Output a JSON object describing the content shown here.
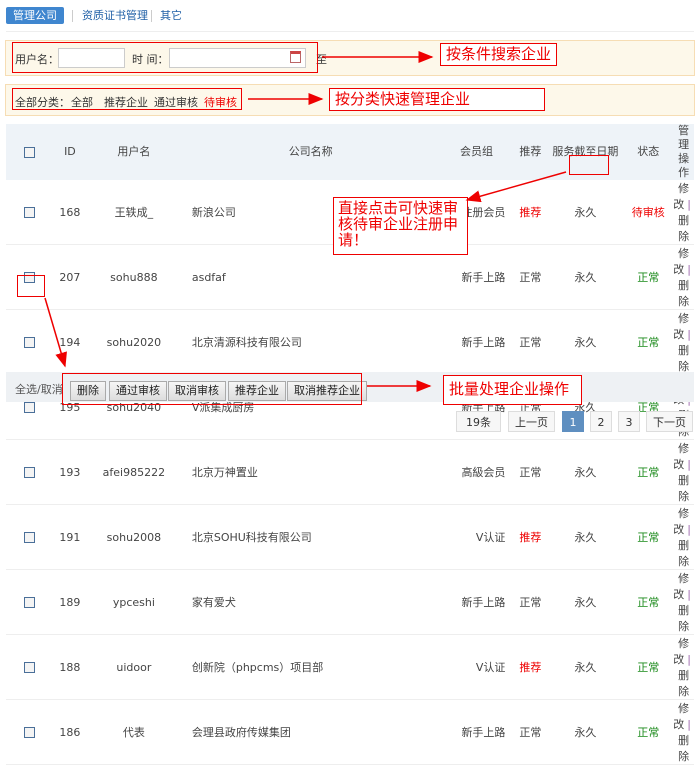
{
  "tabs": [
    {
      "label": "管理公司",
      "active": true
    },
    {
      "label": "资质证书管理"
    },
    {
      "label": "其它"
    }
  ],
  "search": {
    "username_label": "用户名：",
    "username_value": "",
    "time_label": "时 间：",
    "time_value": "",
    "to_label": "至",
    "calendar_icon": "calendar-icon"
  },
  "category": {
    "label": "全部分类：",
    "items": [
      "全部",
      "推荐企业",
      "通过审核",
      "待审核"
    ]
  },
  "annotations": {
    "search": "按条件搜索企业",
    "category": "按分类快速管理企业",
    "status": "直接点击可快速审核待审企业注册申请！",
    "batch": "批量处理企业操作"
  },
  "table": {
    "headers": [
      "ID",
      "用户名",
      "公司名称",
      "会员组",
      "推荐",
      "服务截至日期",
      "状态",
      "管理操作"
    ],
    "rows": [
      {
        "id": "168",
        "user": "王轶成_",
        "company": "新浪公司",
        "group": "注册会员",
        "recommend": "推荐",
        "expire": "永久",
        "status": "待审核"
      },
      {
        "id": "207",
        "user": "sohu888",
        "company": "asdfaf",
        "group": "新手上路",
        "recommend": "正常",
        "expire": "永久",
        "status": "正常"
      },
      {
        "id": "194",
        "user": "sohu2020",
        "company": "北京清源科技有限公司",
        "group": "新手上路",
        "recommend": "正常",
        "expire": "永久",
        "status": "正常"
      },
      {
        "id": "195",
        "user": "sohu2040",
        "company": "V派集成厨房",
        "group": "新手上路",
        "recommend": "正常",
        "expire": "永久",
        "status": "正常"
      },
      {
        "id": "193",
        "user": "afei985222",
        "company": "北京万神置业",
        "group": "高級会员",
        "recommend": "正常",
        "expire": "永久",
        "status": "正常"
      },
      {
        "id": "191",
        "user": "sohu2008",
        "company": "北京SOHU科技有限公司",
        "group": "V认证",
        "recommend": "推荐",
        "expire": "永久",
        "status": "正常"
      },
      {
        "id": "189",
        "user": "ypceshi",
        "company": "家有爱犬",
        "group": "新手上路",
        "recommend": "正常",
        "expire": "永久",
        "status": "正常"
      },
      {
        "id": "188",
        "user": "uidoor",
        "company": "创新院（phpcms）项目部",
        "group": "V认证",
        "recommend": "推荐",
        "expire": "永久",
        "status": "正常"
      },
      {
        "id": "186",
        "user": "代表",
        "company": "会理县政府传媒集团",
        "group": "新手上路",
        "recommend": "正常",
        "expire": "永久",
        "status": "正常"
      }
    ],
    "edit_label": "修改",
    "delete_label": "删除"
  },
  "batch": {
    "select_all": "全选/取消",
    "buttons": [
      "删除",
      "通过审核",
      "取消审核",
      "推荐企业",
      "取消推荐企业"
    ]
  },
  "pagination": {
    "total": "19条",
    "prev": "上一页",
    "pages": [
      "1",
      "2",
      "3"
    ],
    "current": "1",
    "next": "下一页"
  },
  "colors": {
    "accent": "#3f86cf",
    "red": "#ee0000",
    "green": "#1a8a1a"
  }
}
